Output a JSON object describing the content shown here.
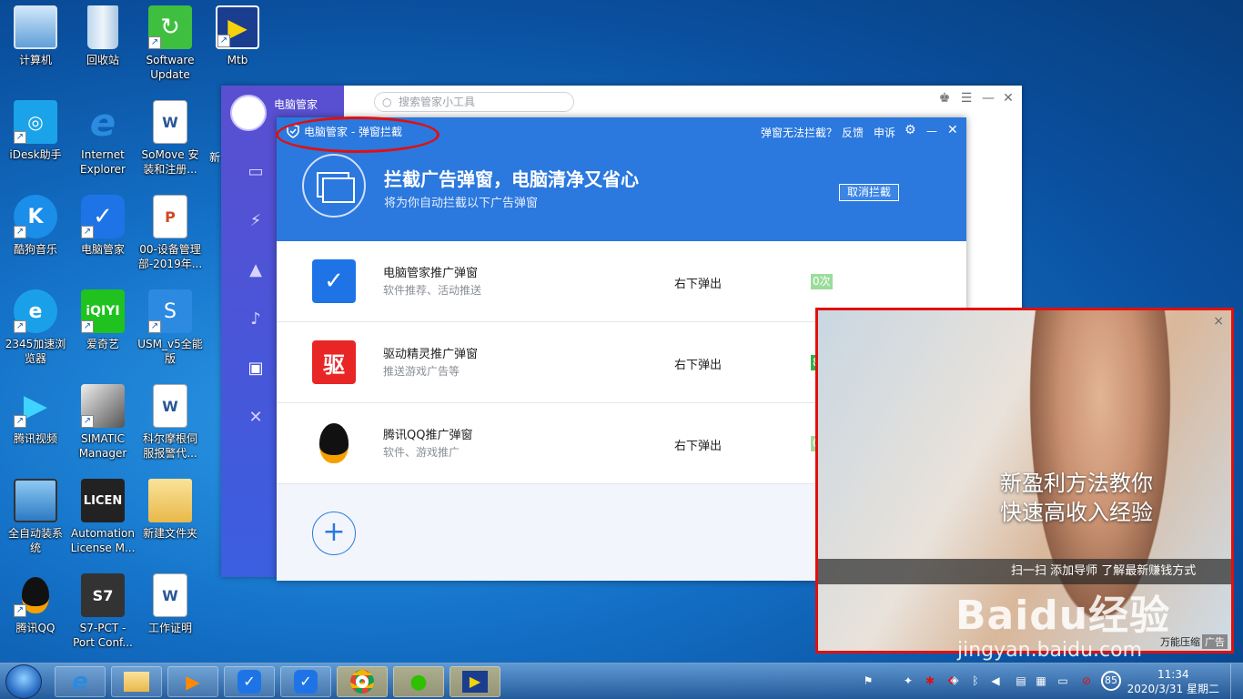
{
  "desktop": {
    "icons": [
      {
        "label": "计算机",
        "icon": "computer-icon"
      },
      {
        "label": "回收站",
        "icon": "recycle-bin-icon"
      },
      {
        "label": "Software\nUpdate",
        "icon": "software-update-icon"
      },
      {
        "label": "Mtb",
        "icon": "mtb-icon"
      },
      {
        "label": "iDesk助手",
        "icon": "idesk-icon"
      },
      {
        "label": "Internet\nExplorer",
        "icon": "internet-explorer-icon"
      },
      {
        "label": "SoMove 安\n装和注册...",
        "icon": "word-doc-icon"
      },
      {
        "label": "酷狗音乐",
        "icon": "kugou-icon"
      },
      {
        "label": "电脑管家",
        "icon": "pc-manager-icon"
      },
      {
        "label": "00-设备管理\n部-2019年...",
        "icon": "ppt-doc-icon"
      },
      {
        "label": "2345加速浏\n览器",
        "icon": "browser-2345-icon"
      },
      {
        "label": "爱奇艺",
        "icon": "iqiyi-icon"
      },
      {
        "label": "USM_v5全能\n版",
        "icon": "usm-icon"
      },
      {
        "label": "腾讯视频",
        "icon": "tencent-video-icon"
      },
      {
        "label": "SIMATIC\nManager",
        "icon": "simatic-icon"
      },
      {
        "label": "科尔摩根伺\n服报警代...",
        "icon": "word-doc-icon"
      },
      {
        "label": "全自动装系\n统",
        "icon": "auto-install-icon"
      },
      {
        "label": "Automation\nLicense M...",
        "icon": "license-icon"
      },
      {
        "label": "新建文件夹",
        "icon": "folder-icon"
      },
      {
        "label": "腾讯QQ",
        "icon": "qq-icon"
      },
      {
        "label": "S7-PCT -\nPort Conf...",
        "icon": "s7pct-icon"
      },
      {
        "label": "工作证明",
        "icon": "word-doc-icon"
      }
    ],
    "partial_label": "新"
  },
  "manager": {
    "title": "电脑管家",
    "search_placeholder": "搜索管家小工具",
    "nav_icons": [
      "monitor-icon",
      "speed-icon",
      "clean-icon",
      "alert-icon",
      "toolbox-icon",
      "app-icon"
    ]
  },
  "dialog": {
    "title": "电脑管家 - 弹窗拦截",
    "header_links": {
      "cant_block": "弹窗无法拦截？",
      "feedback": "反馈",
      "complain": "申诉"
    },
    "headline": "拦截广告弹窗，电脑清净又省心",
    "subtitle": "将为你自动拦截以下广告弹窗",
    "cancel_label": "取消拦截",
    "rows": [
      {
        "name": "电脑管家推广弹窗",
        "desc": "软件推荐、活动推送",
        "position": "右下弹出",
        "count": "0次",
        "count_color": "#9bdc9b"
      },
      {
        "name": "驱动精灵推广弹窗",
        "desc": "推送游戏广告等",
        "position": "右下弹出",
        "count": "8次",
        "count_color": "#2fb34a"
      },
      {
        "name": "腾讯QQ推广弹窗",
        "desc": "软件、游戏推广",
        "position": "右下弹出",
        "count": "0次",
        "count_color": "#9bdc9b"
      }
    ],
    "add_label": "+"
  },
  "ad": {
    "line1": "新盈利方法教你",
    "line2": "快速高收入经验",
    "bar_text": "扫一扫 添加导师 了解最新赚钱方式",
    "brand": "万能压缩",
    "tag": "广告",
    "close": "×"
  },
  "watermark": {
    "text": "Baidu经验",
    "url": "jingyan.baidu.com"
  },
  "taskbar": {
    "apps": [
      "internet-explorer-icon",
      "explorer-icon",
      "media-player-icon",
      "pc-manager-icon",
      "pc-manager-icon",
      "chrome-icon",
      "wechat-icon",
      "mtb-icon"
    ],
    "tray_badge": "85",
    "time": "11:34",
    "date": "2020/3/31 星期二"
  }
}
